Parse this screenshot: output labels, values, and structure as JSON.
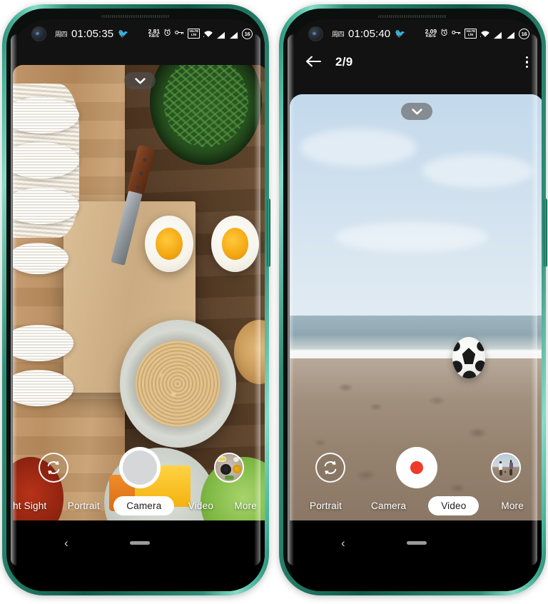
{
  "page": {
    "title": "Two smartphones showing camera app — photo mode and video mode"
  },
  "phones": [
    {
      "id": "phone-left",
      "status_bar": {
        "day": "周四",
        "time": "01:05:35",
        "bird_icon": "bird-icon",
        "net_speed_value": "2.81",
        "net_speed_unit": "KB/S",
        "icons": [
          "alarm-icon",
          "key-icon",
          "volte-icon",
          "wifi-icon",
          "signal-icon",
          "signal-icon"
        ],
        "volte_label_top": "VoLTE",
        "volte_label_bottom": "LTE",
        "battery_level": "16"
      },
      "toolbar": null,
      "viewfinder": {
        "chevron_icon": "chevron-down-icon",
        "scene": "food-flatlay"
      },
      "controls": {
        "flip_icon": "camera-flip-icon",
        "shutter_type": "photo",
        "thumbnail_name": "gallery-thumbnail-spices"
      },
      "modes": [
        {
          "label": "ht Sight",
          "active": false,
          "clipped": true
        },
        {
          "label": "Portrait",
          "active": false,
          "clipped": false
        },
        {
          "label": "Camera",
          "active": true,
          "clipped": false
        },
        {
          "label": "Video",
          "active": false,
          "clipped": false
        },
        {
          "label": "More",
          "active": false,
          "clipped": false
        }
      ],
      "navbar": {
        "back_glyph": "‹",
        "home_pill": "home-pill"
      }
    },
    {
      "id": "phone-right",
      "status_bar": {
        "day": "周四",
        "time": "01:05:40",
        "bird_icon": "bird-icon",
        "net_speed_value": "2.09",
        "net_speed_unit": "KB/S",
        "icons": [
          "alarm-icon",
          "key-icon",
          "volte-icon",
          "wifi-icon",
          "signal-icon",
          "signal-icon"
        ],
        "volte_label_top": "VoLTE",
        "volte_label_bottom": "LTE",
        "battery_level": "16"
      },
      "toolbar": {
        "back_icon": "back-arrow-icon",
        "title": "2/9",
        "menu_icon": "overflow-menu-icon"
      },
      "viewfinder": {
        "chevron_icon": "chevron-down-icon",
        "scene": "beach-football"
      },
      "controls": {
        "flip_icon": "camera-flip-icon",
        "shutter_type": "video",
        "thumbnail_name": "gallery-thumbnail-beach"
      },
      "modes": [
        {
          "label": "Portrait",
          "active": false,
          "clipped": false
        },
        {
          "label": "Camera",
          "active": false,
          "clipped": false
        },
        {
          "label": "Video",
          "active": true,
          "clipped": false
        },
        {
          "label": "More",
          "active": false,
          "clipped": false
        }
      ],
      "navbar": {
        "back_glyph": "‹",
        "home_pill": "home-pill"
      }
    }
  ],
  "colors": {
    "frame_teal": "#2f8f77",
    "frame_teal_light": "#87ddc7",
    "record_red": "#ef3b2b",
    "active_mode_bg": "#ffffff",
    "active_mode_text": "#1d1d1d",
    "navbar_bg": "#000000",
    "shutter_photo_inner": "#d5d7d9"
  }
}
